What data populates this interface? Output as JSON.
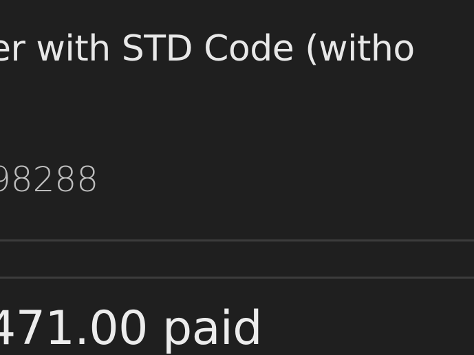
{
  "phone_field": {
    "label": "er with STD Code (witho",
    "value": "98288"
  },
  "payment": {
    "status_text": "471.00 paid"
  },
  "colors": {
    "background": "#1f1f1f",
    "label_text": "#e8e8e8",
    "value_text": "#bdbdbd",
    "divider": "#3c3c3c"
  }
}
